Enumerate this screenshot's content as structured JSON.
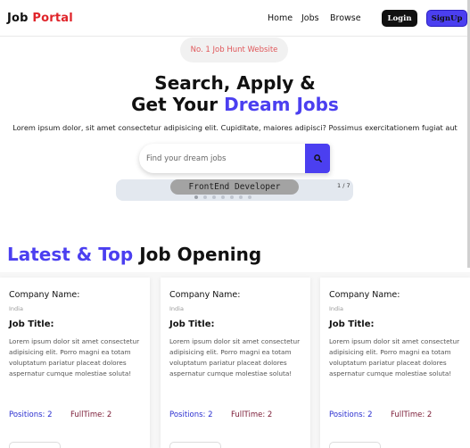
{
  "header": {
    "logo": {
      "prefix": "Job",
      "accent": "Portal"
    },
    "nav": [
      "Home",
      "Jobs",
      "Browse"
    ],
    "login_label": "Login",
    "signup_label": "SignUp"
  },
  "hero": {
    "badge": "No. 1 Job Hunt Website",
    "title_line1": "Search, Apply &",
    "title_line2_prefix": "Get Your",
    "title_line2_accent": "Dream Jobs",
    "description": "Lorem ipsum dolor, sit amet consectetur adipisicing elit. Cupiditate, maiores adipisci? Possimus exercitationem fugiat aut",
    "search_placeholder": "Find your dream jobs"
  },
  "carousel": {
    "current_item": "FrontEnd Developer",
    "counter": "1 / 7"
  },
  "section": {
    "title_accent": "Latest & Top",
    "title_rest": "Job Opening"
  },
  "jobs": [
    {
      "company": "Company Name:",
      "location": "India",
      "title": "Job Title:",
      "description": "Lorem ipsum dolor sit amet consectetur adipisicing elit. Porro magni ea totam voluptatum pariatur placeat dolores aspernatur cumque molestiae soluta!",
      "positions": "Positions: 2",
      "type": "FullTime: 2"
    },
    {
      "company": "Company Name:",
      "location": "India",
      "title": "Job Title:",
      "description": "Lorem ipsum dolor sit amet consectetur adipisicing elit. Porro magni ea totam voluptatum pariatur placeat dolores aspernatur cumque molestiae soluta!",
      "positions": "Positions: 2",
      "type": "FullTime: 2"
    },
    {
      "company": "Company Name:",
      "location": "India",
      "title": "Job Title:",
      "description": "Lorem ipsum dolor sit amet consectetur adipisicing elit. Porro magni ea totam voluptatum pariatur placeat dolores aspernatur cumque molestiae soluta!",
      "positions": "Positions: 2",
      "type": "FullTime: 2"
    }
  ],
  "colors": {
    "accent": "#4b3ff0",
    "brand_red": "#e0242a"
  },
  "icons": {
    "search": "search-icon"
  }
}
